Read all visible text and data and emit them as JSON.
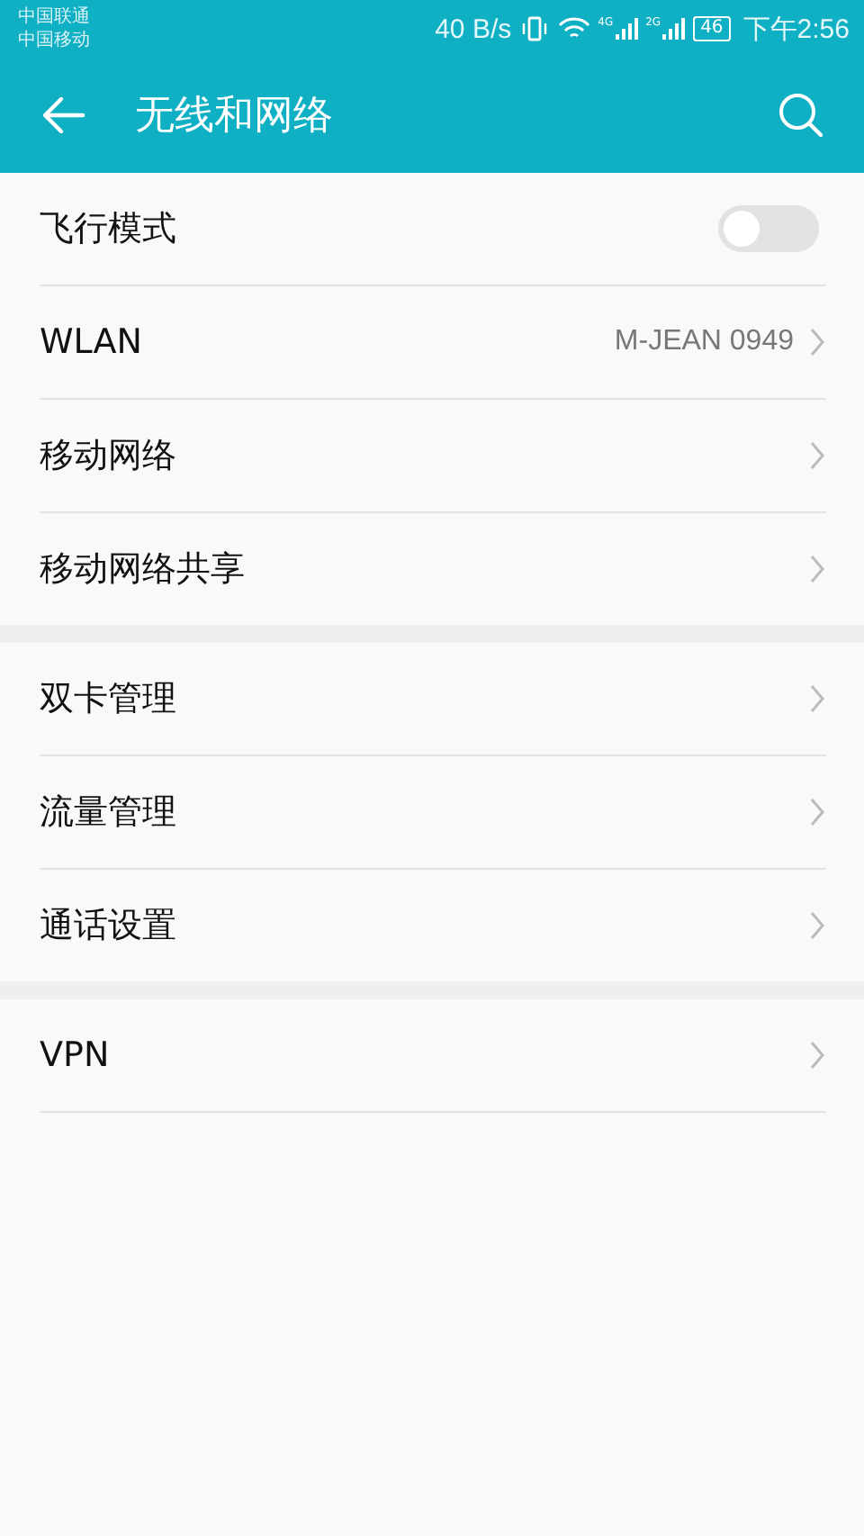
{
  "status_bar": {
    "carriers": [
      "中国联通",
      "中国移动"
    ],
    "speed": "40 B/s",
    "signals": [
      "4G",
      "2G"
    ],
    "battery": "46",
    "time": "下午2:56"
  },
  "header": {
    "title": "无线和网络"
  },
  "groups": [
    {
      "items": [
        {
          "kind": "toggle",
          "label": "飞行模式",
          "on": false
        },
        {
          "kind": "link",
          "label": "WLAN",
          "value": "M-JEAN 0949"
        },
        {
          "kind": "link",
          "label": "移动网络"
        },
        {
          "kind": "link",
          "label": "移动网络共享"
        }
      ]
    },
    {
      "items": [
        {
          "kind": "link",
          "label": "双卡管理"
        },
        {
          "kind": "link",
          "label": "流量管理"
        },
        {
          "kind": "link",
          "label": "通话设置"
        }
      ]
    },
    {
      "items": [
        {
          "kind": "link",
          "label": "VPN"
        }
      ]
    }
  ]
}
